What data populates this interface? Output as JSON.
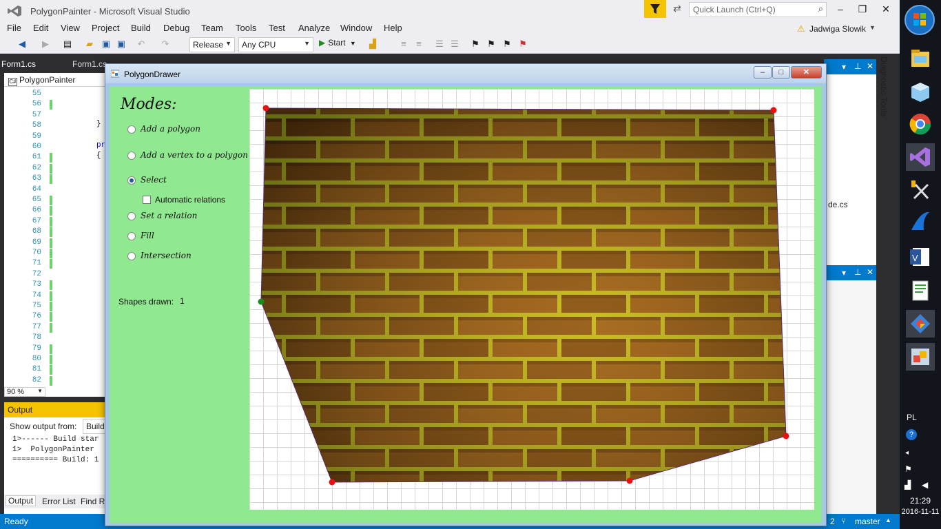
{
  "vs": {
    "window_title": "PolygonPainter - Microsoft Visual Studio",
    "quick_launch_placeholder": "Quick Launch (Ctrl+Q)",
    "user_name": "Jadwiga Slowik",
    "menu": [
      "File",
      "Edit",
      "View",
      "Project",
      "Build",
      "Debug",
      "Team",
      "Tools",
      "Test",
      "Analyze",
      "Window",
      "Help"
    ],
    "toolbar": {
      "configuration": "Release",
      "platform": "Any CPU",
      "start_label": "Start"
    },
    "doc_tabs": [
      "Form1.cs",
      "Form1.cs"
    ],
    "editor_nav": "PolygonPainter",
    "line_numbers": [
      "55",
      "56",
      "57",
      "58",
      "59",
      "60",
      "61",
      "62",
      "63",
      "64",
      "65",
      "66",
      "67",
      "68",
      "69",
      "70",
      "71",
      "72",
      "73",
      "74",
      "75",
      "76",
      "77",
      "78",
      "79",
      "80",
      "81",
      "82"
    ],
    "code_fragments": {
      "line58": "}",
      "line60": "pr",
      "line61": "{"
    },
    "zoom": "90 %",
    "output": {
      "title": "Output",
      "show_from_label": "Show output from:",
      "show_from_value": "Build",
      "lines": [
        "1>------ Build star",
        "1>  PolygonPainter",
        "========== Build: 1"
      ],
      "tabs": [
        "Output",
        "Error List",
        "Find R"
      ]
    },
    "right_panel_file": "de.cs",
    "diagnostic_tools": "Diagnostic Tools",
    "status": {
      "ready": "Ready",
      "num": "2",
      "branch": "master"
    }
  },
  "taskbar": {
    "lang": "PL",
    "time": "21:29",
    "date": "2016-11-11",
    "apps": [
      "explorer-icon",
      "3d-box-icon",
      "chrome-icon",
      "visual-studio-icon",
      "tools-icon",
      "shark-fin-icon",
      "word-icon",
      "notepad-icon",
      "git-icon",
      "remote-desktop-icon"
    ]
  },
  "form": {
    "title": "PolygonDrawer",
    "modes_title": "Modes:",
    "modes": [
      {
        "label": "Add a polygon",
        "checked": false
      },
      {
        "label": "Add a vertex to a polygon",
        "checked": false
      },
      {
        "label": "Select",
        "checked": true
      },
      {
        "label": "Set a relation",
        "checked": false
      },
      {
        "label": "Fill",
        "checked": false
      },
      {
        "label": "Intersection",
        "checked": false
      }
    ],
    "automatic_relations_label": "Automatic relations",
    "automatic_relations_checked": false,
    "shapes_drawn_label": "Shapes drawn:",
    "shapes_drawn_value": "1",
    "fill": "brick-wall-texture",
    "vertex_color": "#e81010",
    "selected_vertex_color": "#1a8c1a"
  },
  "colors": {
    "vs_accent": "#007acc",
    "output_header": "#f5c400",
    "form_background": "#90e890"
  }
}
